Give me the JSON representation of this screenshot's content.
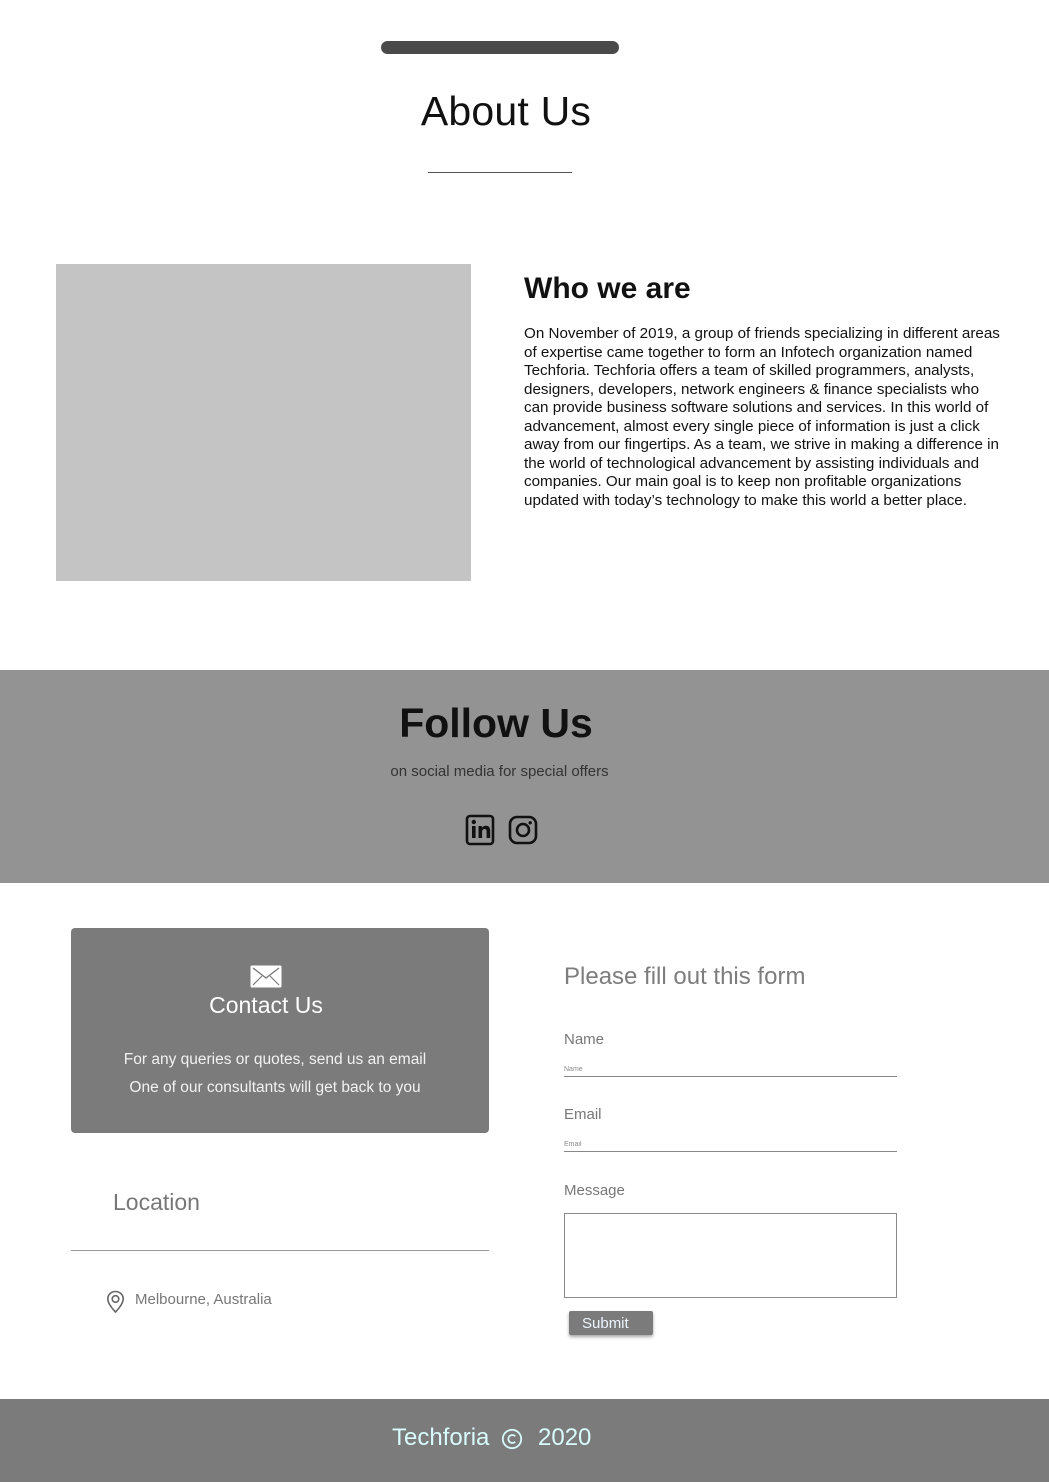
{
  "about": {
    "title": "About Us",
    "who_title": "Who we are",
    "who_text": "On November of 2019, a group of friends specializing in different areas of expertise came together to form an Infotech organization named Techforia. Techforia offers a team of skilled programmers, analysts, designers, developers, network engineers & finance specialists who can provide business software solutions and services. In this world of advancement, almost every single piece of information is just a click away from our fingertips. As a team, we strive in making a difference in the world of technological advancement by assisting individuals and companies. Our main goal is to keep non profitable organizations updated with today’s technology to make this world a better place."
  },
  "follow": {
    "title": "Follow Us",
    "subtitle": "on social media for special offers",
    "icons": [
      "linkedin-icon",
      "instagram-icon"
    ]
  },
  "contact": {
    "title": "Contact Us",
    "line1": "For any queries or quotes, send us an email",
    "line2": "One of our consultants will get back to you"
  },
  "location": {
    "title": "Location",
    "address": "Melbourne, Australia"
  },
  "form": {
    "title": "Please fill out this form",
    "name_label": "Name",
    "name_placeholder": "Name",
    "email_label": "Email",
    "email_placeholder": "Email",
    "message_label": "Message",
    "submit_label": "Submit"
  },
  "footer": {
    "brand": "Techforia",
    "year": "2020"
  },
  "colors": {
    "follow_bg": "#939393",
    "card_bg": "#7b7b7b",
    "footer_bg": "#7b7b7b",
    "footer_text": "#d8fbfb",
    "image_placeholder": "#c4c4c4"
  }
}
